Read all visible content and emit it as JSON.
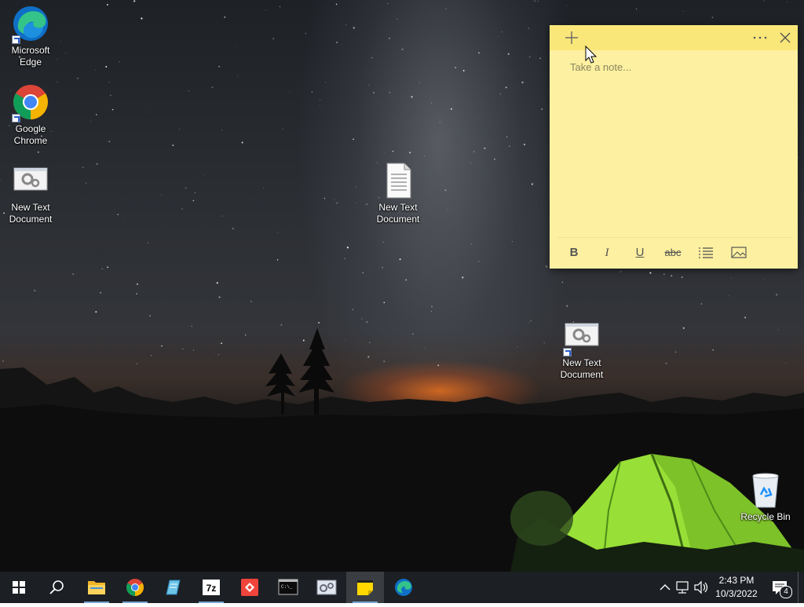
{
  "desktop": {
    "icons": [
      {
        "label": "Microsoft Edge",
        "icon": "edge-icon",
        "shortcut": true
      },
      {
        "label": "Google Chrome",
        "icon": "chrome-icon",
        "shortcut": true
      },
      {
        "label": "New Text Document",
        "icon": "settings-doc-icon",
        "shortcut": false
      },
      {
        "label": "New Text Document",
        "icon": "text-file-icon",
        "shortcut": false
      },
      {
        "label": "New Text Document",
        "icon": "settings-doc-icon",
        "shortcut": true
      },
      {
        "label": "Recycle Bin",
        "icon": "recycle-bin-icon",
        "shortcut": false
      }
    ]
  },
  "sticky_note": {
    "placeholder": "Take a note...",
    "value": "",
    "toolbar": [
      "B",
      "I",
      "U",
      "abc"
    ],
    "colors": {
      "header": "#fae779",
      "body": "#fdf0a0"
    }
  },
  "taskbar": {
    "apps": [
      {
        "name": "file-explorer",
        "running": true,
        "active": false
      },
      {
        "name": "google-chrome",
        "running": true,
        "active": false
      },
      {
        "name": "notepad",
        "running": false,
        "active": false
      },
      {
        "name": "7-zip",
        "running": true,
        "active": false
      },
      {
        "name": "anydesk",
        "running": false,
        "active": false
      },
      {
        "name": "command-prompt",
        "running": false,
        "active": false
      },
      {
        "name": "control-panel",
        "running": false,
        "active": false
      },
      {
        "name": "sticky-notes",
        "running": true,
        "active": true
      },
      {
        "name": "microsoft-edge",
        "running": false,
        "active": false
      }
    ],
    "clock": {
      "time": "2:43 PM",
      "date": "10/3/2022"
    },
    "notification_count": "4"
  }
}
